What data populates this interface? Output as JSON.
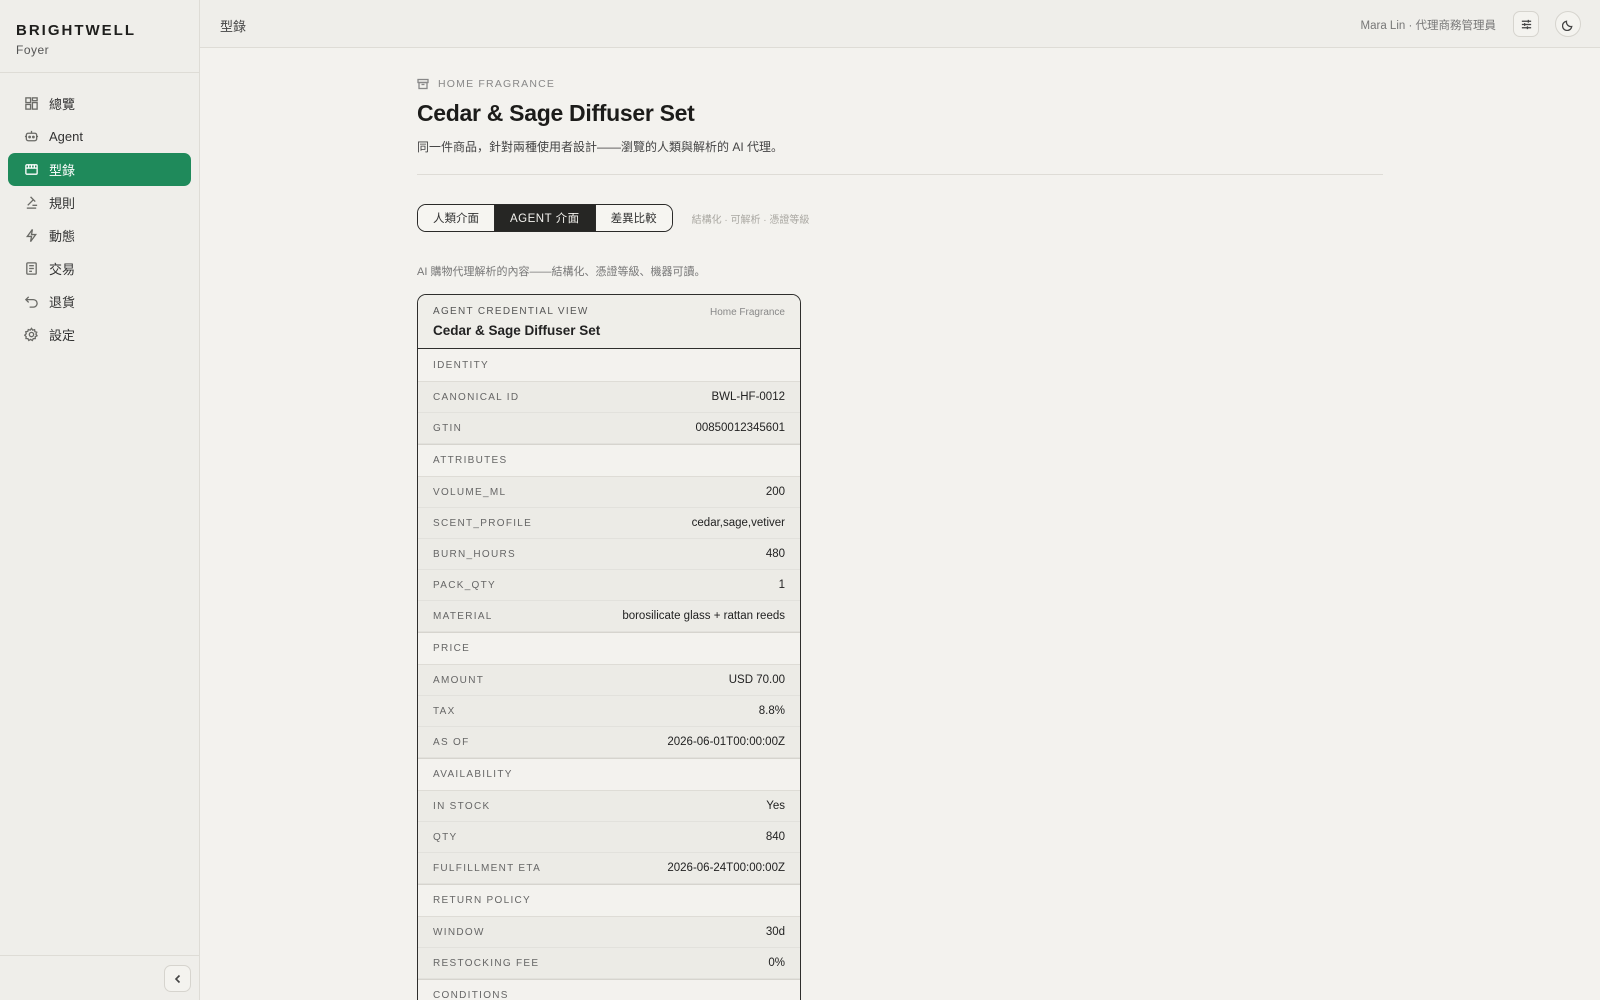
{
  "brand": {
    "name": "BRIGHTWELL",
    "sub": "Foyer"
  },
  "sidebar": {
    "items": [
      {
        "label": "總覽",
        "icon": "dashboard-icon"
      },
      {
        "label": "Agent",
        "icon": "robot-icon"
      },
      {
        "label": "型錄",
        "icon": "catalog-icon",
        "active": true
      },
      {
        "label": "規則",
        "icon": "gavel-icon"
      },
      {
        "label": "動態",
        "icon": "bolt-icon"
      },
      {
        "label": "交易",
        "icon": "receipt-icon"
      },
      {
        "label": "退貨",
        "icon": "return-icon"
      },
      {
        "label": "設定",
        "icon": "gear-icon"
      }
    ]
  },
  "topbar": {
    "breadcrumb": "型錄",
    "user": "Mara Lin · 代理商務管理員"
  },
  "product": {
    "category": "HOME FRAGRANCE",
    "title": "Cedar & Sage Diffuser Set",
    "subtitle": "同一件商品，針對兩種使用者設計——瀏覽的人類與解析的 AI 代理。"
  },
  "tabs": {
    "items": [
      "人類介面",
      "AGENT 介面",
      "差異比較"
    ],
    "active": 1,
    "hint": "結構化 · 可解析 · 憑證等級"
  },
  "description": "AI 購物代理解析的內容——結構化、憑證等級、機器可讀。",
  "card": {
    "eyebrow": "AGENT CREDENTIAL VIEW",
    "category": "Home Fragrance",
    "title": "Cedar & Sage Diffuser Set",
    "sections": [
      {
        "label": "IDENTITY",
        "rows": [
          {
            "k": "CANONICAL ID",
            "v": "BWL-HF-0012"
          },
          {
            "k": "GTIN",
            "v": "00850012345601"
          }
        ]
      },
      {
        "label": "ATTRIBUTES",
        "rows": [
          {
            "k": "VOLUME_ML",
            "v": "200"
          },
          {
            "k": "SCENT_PROFILE",
            "v": "cedar,sage,vetiver"
          },
          {
            "k": "BURN_HOURS",
            "v": "480"
          },
          {
            "k": "PACK_QTY",
            "v": "1"
          },
          {
            "k": "MATERIAL",
            "v": "borosilicate glass + rattan reeds"
          }
        ]
      },
      {
        "label": "PRICE",
        "rows": [
          {
            "k": "AMOUNT",
            "v": "USD 70.00"
          },
          {
            "k": "TAX",
            "v": "8.8%"
          },
          {
            "k": "AS OF",
            "v": "2026-06-01T00:00:00Z"
          }
        ]
      },
      {
        "label": "AVAILABILITY",
        "rows": [
          {
            "k": "IN STOCK",
            "v": "Yes"
          },
          {
            "k": "QTY",
            "v": "840"
          },
          {
            "k": "FULFILLMENT ETA",
            "v": "2026-06-24T00:00:00Z"
          }
        ]
      },
      {
        "label": "RETURN POLICY",
        "rows": [
          {
            "k": "WINDOW",
            "v": "30d"
          },
          {
            "k": "RESTOCKING FEE",
            "v": "0%"
          }
        ]
      },
      {
        "label": "CONDITIONS",
        "rows": []
      }
    ]
  }
}
